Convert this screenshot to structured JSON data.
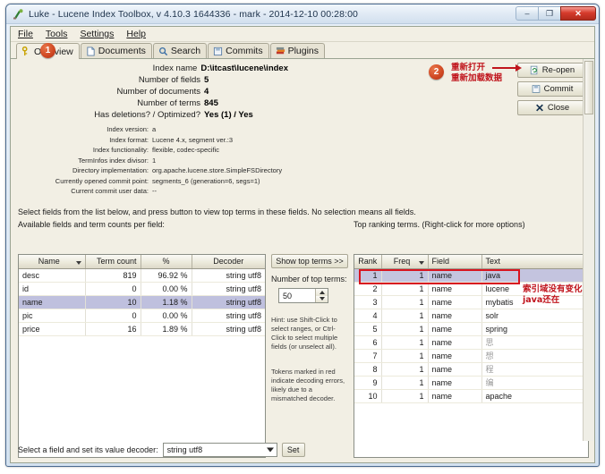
{
  "window": {
    "title": "Luke - Lucene Index Toolbox, v 4.10.3 1644336 - mark - 2014-12-10 00:28:00",
    "icon": "luke-icon",
    "buttons": {
      "minimize": "–",
      "maximize": "❐",
      "close": "✕"
    }
  },
  "menubar": {
    "items": [
      {
        "label": "File"
      },
      {
        "label": "Tools"
      },
      {
        "label": "Settings"
      },
      {
        "label": "Help"
      }
    ]
  },
  "tabs": [
    {
      "label": "Overview",
      "icon": "key-icon",
      "active": true
    },
    {
      "label": "Documents",
      "icon": "document-icon",
      "active": false
    },
    {
      "label": "Search",
      "icon": "search-icon",
      "active": false
    },
    {
      "label": "Commits",
      "icon": "save-icon",
      "active": false
    },
    {
      "label": "Plugins",
      "icon": "plugins-icon",
      "active": false
    }
  ],
  "overview": {
    "primary_rows": [
      {
        "label": "Index name",
        "value": "D:\\itcast\\lucene\\index"
      },
      {
        "label": "Number of fields",
        "value": "5"
      },
      {
        "label": "Number of documents",
        "value": "4"
      },
      {
        "label": "Number of terms",
        "value": "845"
      },
      {
        "label": "Has deletions? / Optimized?",
        "value": "Yes (1) / Yes"
      }
    ],
    "secondary_rows": [
      {
        "label": "Index version:",
        "value": "a"
      },
      {
        "label": "Index format:",
        "value": "Lucene 4.x, segment ver.:3"
      },
      {
        "label": "Index functionality:",
        "value": "flexible, codec-specific"
      },
      {
        "label": "TermInfos index divisor:",
        "value": "1"
      },
      {
        "label": "Directory implementation:",
        "value": "org.apache.lucene.store.SimpleFSDirectory"
      },
      {
        "label": "Currently opened commit point:",
        "value": "segments_6 (generation=6, segs=1)"
      },
      {
        "label": "Current commit user data:",
        "value": "--"
      }
    ],
    "buttons": [
      {
        "label": "Re-open",
        "icon": "reopen-icon"
      },
      {
        "label": "Commit",
        "icon": "commit-icon"
      },
      {
        "label": "Close",
        "icon": "close-x-icon"
      }
    ]
  },
  "annotations": {
    "badge1": "1",
    "badge2": "2",
    "reopen_note_line1": "重新打开",
    "reopen_note_line2": "重新加载数据",
    "terms_note_line1": "索引域没有变化",
    "terms_note_line2": "java还在",
    "accent_red": "#c0141c",
    "badge_orange": "#cf4722"
  },
  "instructions": {
    "select_fields": "Select fields from the list below, and press button to view top terms in these fields. No selection means all fields.",
    "available_fields": "Available fields and term counts per field:",
    "top_ranking": "Top ranking terms. (Right-click for more options)"
  },
  "fields_table": {
    "columns": [
      "Name",
      "Term count",
      "%",
      "Decoder"
    ],
    "sorted_column": "Name",
    "rows": [
      {
        "name": "desc",
        "term_count": "819",
        "pct": "96.92 %",
        "decoder": "string utf8",
        "selected": false
      },
      {
        "name": "id",
        "term_count": "0",
        "pct": "0.00 %",
        "decoder": "string utf8",
        "selected": false
      },
      {
        "name": "name",
        "term_count": "10",
        "pct": "1.18 %",
        "decoder": "string utf8",
        "selected": true
      },
      {
        "name": "pic",
        "term_count": "0",
        "pct": "0.00 %",
        "decoder": "string utf8",
        "selected": false
      },
      {
        "name": "price",
        "term_count": "16",
        "pct": "1.89 %",
        "decoder": "string utf8",
        "selected": false
      }
    ]
  },
  "terms_table": {
    "columns": [
      "Rank",
      "Freq",
      "Field",
      "Text"
    ],
    "sorted_column": "Freq",
    "rows": [
      {
        "rank": "1",
        "freq": "1",
        "field": "name",
        "text": "java",
        "selected": true
      },
      {
        "rank": "2",
        "freq": "1",
        "field": "name",
        "text": "lucene",
        "selected": false
      },
      {
        "rank": "3",
        "freq": "1",
        "field": "name",
        "text": "mybatis",
        "selected": false
      },
      {
        "rank": "4",
        "freq": "1",
        "field": "name",
        "text": "solr",
        "selected": false
      },
      {
        "rank": "5",
        "freq": "1",
        "field": "name",
        "text": "spring",
        "selected": false
      },
      {
        "rank": "6",
        "freq": "1",
        "field": "name",
        "text": "思",
        "selected": false
      },
      {
        "rank": "7",
        "freq": "1",
        "field": "name",
        "text": "想",
        "selected": false
      },
      {
        "rank": "8",
        "freq": "1",
        "field": "name",
        "text": "程",
        "selected": false
      },
      {
        "rank": "9",
        "freq": "1",
        "field": "name",
        "text": "编",
        "selected": false
      },
      {
        "rank": "10",
        "freq": "1",
        "field": "name",
        "text": "apache",
        "selected": false
      }
    ]
  },
  "mid_controls": {
    "show_top_terms_button": "Show top terms >>",
    "number_label": "Number of top terms:",
    "number_value": "50",
    "hint1": "Hint: use Shift-Click to select ranges, or Ctrl-Click to select multiple fields (or unselect all).",
    "hint2": "Tokens marked in red indicate decoding errors, likely due to a mismatched decoder."
  },
  "bottom": {
    "label": "Select a field and set its value decoder:",
    "decoder_value": "string utf8",
    "set_button": "Set"
  }
}
